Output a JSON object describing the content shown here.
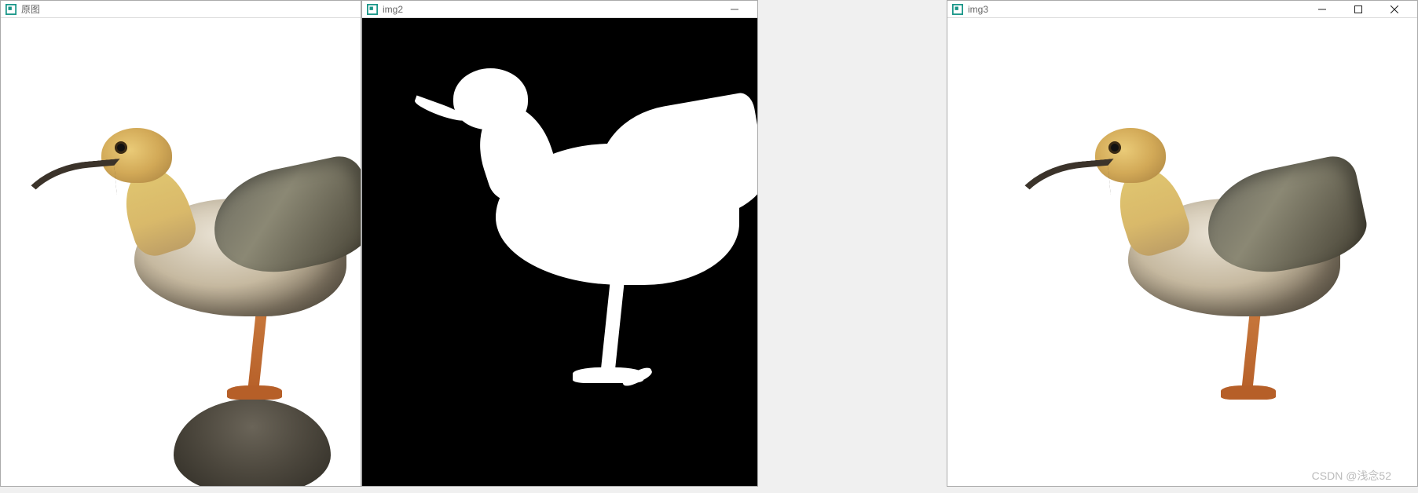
{
  "windows": [
    {
      "title": "原图",
      "controls": false
    },
    {
      "title": "img2",
      "controls": false
    },
    {
      "title": "img3",
      "controls": true
    }
  ],
  "controls": {
    "minimize_tooltip": "Minimize",
    "maximize_tooltip": "Maximize",
    "close_tooltip": "Close"
  },
  "watermark": "CSDN @浅念52"
}
